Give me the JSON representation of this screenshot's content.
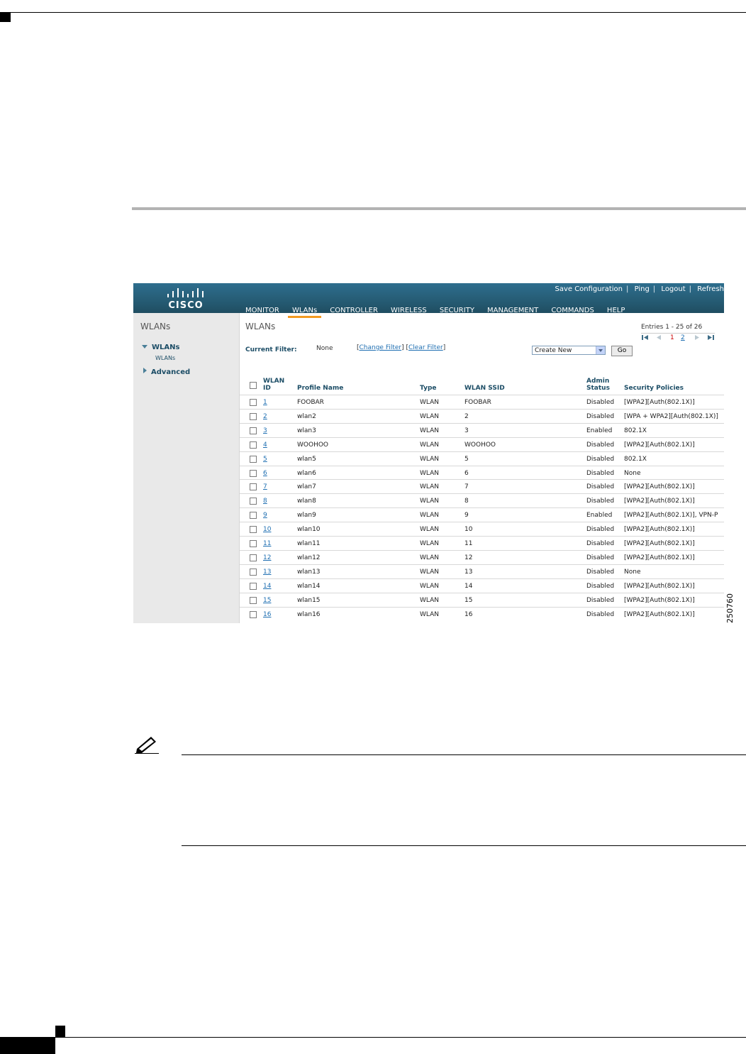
{
  "figure_number": "250760",
  "app": {
    "logo_text": "CISCO",
    "utility_links": [
      "Save Configuration",
      "Ping",
      "Logout",
      "Refresh"
    ],
    "menu": [
      "MONITOR",
      "WLANs",
      "CONTROLLER",
      "WIRELESS",
      "SECURITY",
      "MANAGEMENT",
      "COMMANDS",
      "HELP"
    ],
    "active_menu": "WLANs"
  },
  "sidebar": {
    "title": "WLANs",
    "items": [
      {
        "label": "WLANs",
        "expanded": true,
        "subitems": [
          "WLANs"
        ]
      },
      {
        "label": "Advanced",
        "expanded": false
      }
    ]
  },
  "main": {
    "title": "WLANs",
    "entries_text": "Entries 1 - 25 of 26",
    "pager": {
      "pages": [
        "1",
        "2"
      ],
      "current": "1"
    },
    "filter": {
      "label": "Current Filter:",
      "value": "None",
      "change_label": "Change Filter",
      "clear_label": "Clear Filter"
    },
    "action_select": {
      "value": "Create New"
    },
    "go_label": "Go",
    "table": {
      "headers": {
        "id_line1": "WLAN",
        "id_line2": "ID",
        "profile": "Profile Name",
        "type": "Type",
        "ssid": "WLAN SSID",
        "status_line1": "Admin",
        "status_line2": "Status",
        "security": "Security Policies"
      },
      "rows": [
        {
          "id": "1",
          "profile": "FOOBAR",
          "type": "WLAN",
          "ssid": "FOOBAR",
          "status": "Disabled",
          "security": "[WPA2][Auth(802.1X)]"
        },
        {
          "id": "2",
          "profile": "wlan2",
          "type": "WLAN",
          "ssid": "2",
          "status": "Disabled",
          "security": "[WPA + WPA2][Auth(802.1X)]"
        },
        {
          "id": "3",
          "profile": "wlan3",
          "type": "WLAN",
          "ssid": "3",
          "status": "Enabled",
          "security": "802.1X"
        },
        {
          "id": "4",
          "profile": "WOOHOO",
          "type": "WLAN",
          "ssid": "WOOHOO",
          "status": "Disabled",
          "security": "[WPA2][Auth(802.1X)]"
        },
        {
          "id": "5",
          "profile": "wlan5",
          "type": "WLAN",
          "ssid": "5",
          "status": "Disabled",
          "security": "802.1X"
        },
        {
          "id": "6",
          "profile": "wlan6",
          "type": "WLAN",
          "ssid": "6",
          "status": "Disabled",
          "security": "None"
        },
        {
          "id": "7",
          "profile": "wlan7",
          "type": "WLAN",
          "ssid": "7",
          "status": "Disabled",
          "security": "[WPA2][Auth(802.1X)]"
        },
        {
          "id": "8",
          "profile": "wlan8",
          "type": "WLAN",
          "ssid": "8",
          "status": "Disabled",
          "security": "[WPA2][Auth(802.1X)]"
        },
        {
          "id": "9",
          "profile": "wlan9",
          "type": "WLAN",
          "ssid": "9",
          "status": "Enabled",
          "security": "[WPA2][Auth(802.1X)], VPN-P"
        },
        {
          "id": "10",
          "profile": "wlan10",
          "type": "WLAN",
          "ssid": "10",
          "status": "Disabled",
          "security": "[WPA2][Auth(802.1X)]"
        },
        {
          "id": "11",
          "profile": "wlan11",
          "type": "WLAN",
          "ssid": "11",
          "status": "Disabled",
          "security": "[WPA2][Auth(802.1X)]"
        },
        {
          "id": "12",
          "profile": "wlan12",
          "type": "WLAN",
          "ssid": "12",
          "status": "Disabled",
          "security": "[WPA2][Auth(802.1X)]"
        },
        {
          "id": "13",
          "profile": "wlan13",
          "type": "WLAN",
          "ssid": "13",
          "status": "Disabled",
          "security": "None"
        },
        {
          "id": "14",
          "profile": "wlan14",
          "type": "WLAN",
          "ssid": "14",
          "status": "Disabled",
          "security": "[WPA2][Auth(802.1X)]"
        },
        {
          "id": "15",
          "profile": "wlan15",
          "type": "WLAN",
          "ssid": "15",
          "status": "Disabled",
          "security": "[WPA2][Auth(802.1X)]"
        },
        {
          "id": "16",
          "profile": "wlan16",
          "type": "WLAN",
          "ssid": "16",
          "status": "Disabled",
          "security": "[WPA2][Auth(802.1X)]"
        }
      ]
    }
  },
  "colors": {
    "header_bg": "#24586f",
    "active_tab_underline": "#f39a21",
    "link": "#1f6fb2",
    "sidebar_bg": "#e9e9e9"
  }
}
